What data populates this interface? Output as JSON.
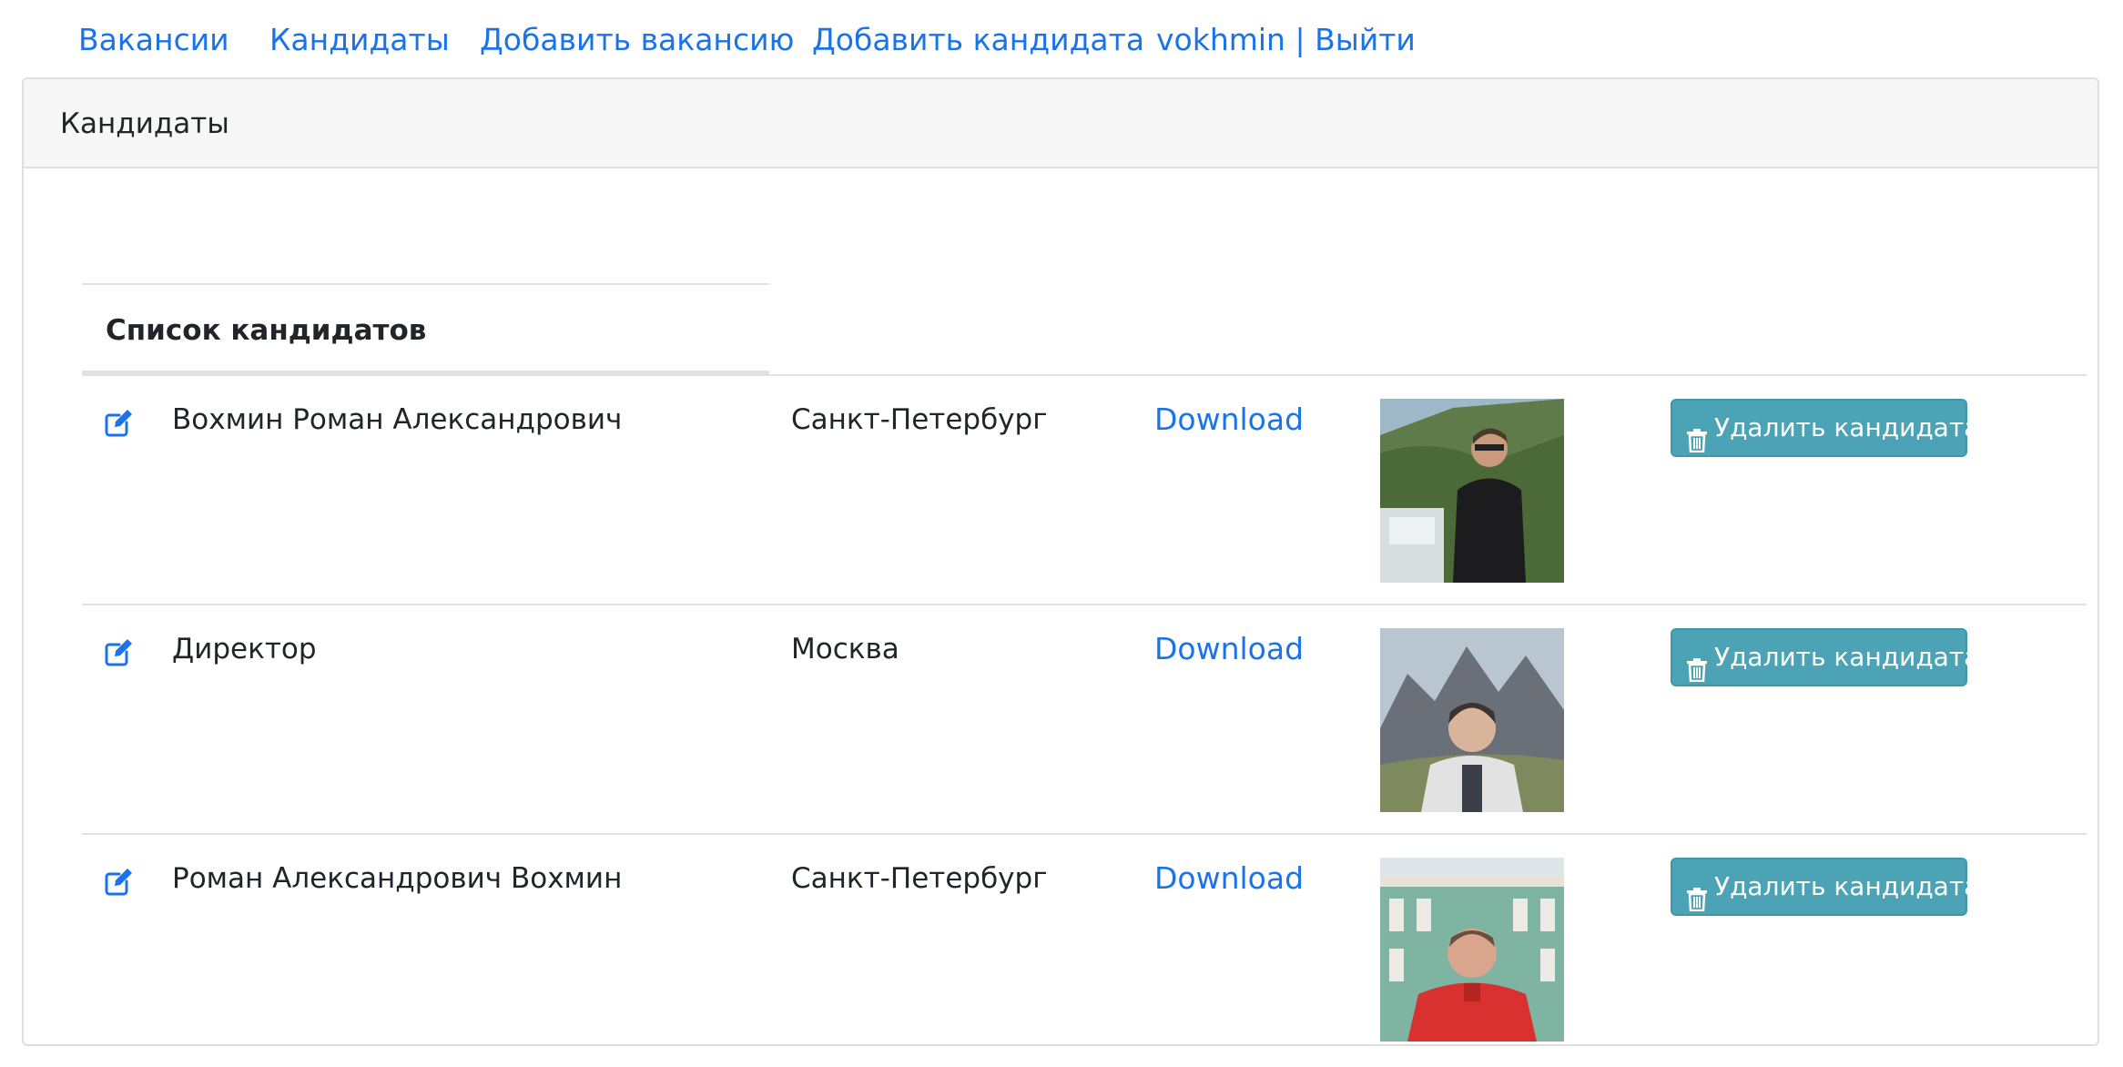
{
  "nav": {
    "items": [
      {
        "label": "Вакансии"
      },
      {
        "label": "Кандидаты"
      },
      {
        "label": "Добавить вакансию"
      },
      {
        "label": "Добавить кандидата"
      },
      {
        "label": "vokhmin | Выйти"
      }
    ]
  },
  "card": {
    "title": "Кандидаты",
    "table_header": "Список кандидатов"
  },
  "candidates": [
    {
      "name": "Вохмин Роман Александрович",
      "city": "Санкт-Петербург",
      "download_label": "Download",
      "photo_icon": "person-photo-hillside",
      "delete_label": "Удалить кандидата"
    },
    {
      "name": "Директор",
      "city": "Москва",
      "download_label": "Download",
      "photo_icon": "person-photo-mountains",
      "delete_label": "Удалить кандидата"
    },
    {
      "name": "Роман Александрович Вохмин",
      "city": "Санкт-Петербург",
      "download_label": "Download",
      "photo_icon": "person-photo-palace",
      "delete_label": "Удалить кандидата"
    }
  ],
  "colors": {
    "link": "#1a73e8",
    "delete_button": "#4da3b6",
    "card_header_bg": "#f7f7f7",
    "border": "#dee2e6"
  }
}
